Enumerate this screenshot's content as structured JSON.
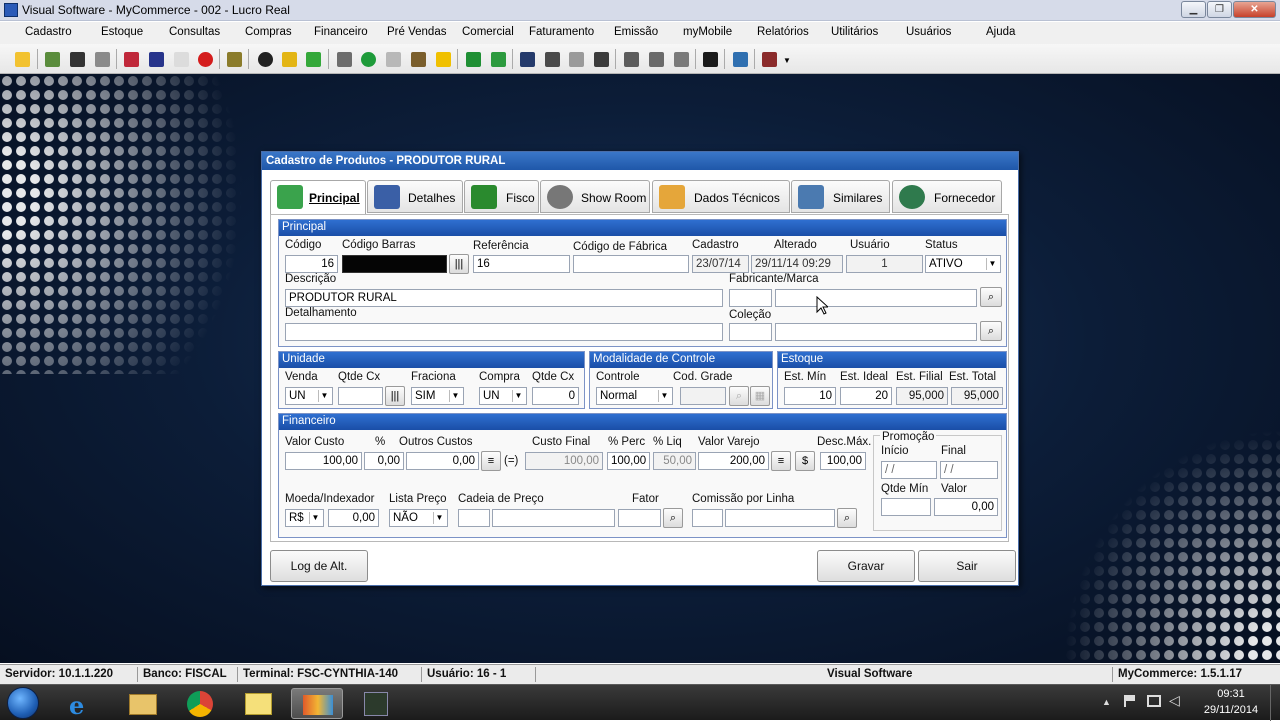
{
  "window": {
    "title": "Visual Software - MyCommerce - 002 - Lucro Real"
  },
  "menu": [
    "Cadastro",
    "Estoque",
    "Consultas",
    "Compras",
    "Financeiro",
    "Pré Vendas",
    "Comercial",
    "Faturamento",
    "Emissão",
    "myMobile",
    "Relatórios",
    "Utilitários",
    "Usuários",
    "Ajuda"
  ],
  "dialog": {
    "title": "Cadastro de Produtos - PRODUTOR RURAL",
    "tabs": [
      "Principal",
      "Detalhes",
      "Fisco",
      "Show Room",
      "Dados Técnicos",
      "Similares",
      "Fornecedor"
    ],
    "principal": {
      "header": "Principal",
      "codigo_label": "Código",
      "codigo": "16",
      "codigo_barras_label": "Código Barras",
      "referencia_label": "Referência",
      "referencia": "16",
      "codigo_fabrica_label": "Código de Fábrica",
      "cadastro_label": "Cadastro",
      "cadastro": "23/07/14",
      "alterado_label": "Alterado",
      "alterado": "29/11/14 09:29",
      "usuario_label": "Usuário",
      "usuario": "1",
      "status_label": "Status",
      "status": "ATIVO",
      "descricao_label": "Descrição",
      "descricao": "PRODUTOR RURAL",
      "fabricante_label": "Fabricante/Marca",
      "detalhamento_label": "Detalhamento",
      "colecao_label": "Coleção"
    },
    "unidade": {
      "header": "Unidade",
      "venda_label": "Venda",
      "venda": "UN",
      "qtde_cx_label": "Qtde Cx",
      "fraciona_label": "Fraciona",
      "fraciona": "SIM",
      "compra_label": "Compra",
      "compra": "UN",
      "qtde_cx2_label": "Qtde Cx",
      "qtde_cx2": "0"
    },
    "modalidade": {
      "header": "Modalidade de Controle",
      "controle_label": "Controle",
      "controle": "Normal",
      "cod_grade_label": "Cod. Grade"
    },
    "estoque": {
      "header": "Estoque",
      "est_min_label": "Est. Mín",
      "est_min": "10",
      "est_ideal_label": "Est. Ideal",
      "est_ideal": "20",
      "est_filial_label": "Est. Filial",
      "est_filial": "95,000",
      "est_total_label": "Est. Total",
      "est_total": "95,000"
    },
    "financeiro": {
      "header": "Financeiro",
      "valor_custo_label": "Valor Custo",
      "valor_custo": "100,00",
      "pct_label": "%",
      "pct": "0,00",
      "outros_custos_label": "Outros Custos",
      "outros_custos": "0,00",
      "equals": "(=)",
      "custo_final_label": "Custo Final",
      "custo_final": "100,00",
      "pct_perc_label": "% Perc",
      "pct_perc": "100,00",
      "pct_liq_label": "% Liq",
      "pct_liq": "50,00",
      "valor_varejo_label": "Valor Varejo",
      "valor_varejo": "200,00",
      "dollar": "$",
      "desc_max_label": "Desc.Máx.",
      "desc_max": "100,00",
      "moeda_label": "Moeda/Indexador",
      "moeda": "R$",
      "indexador": "0,00",
      "lista_preco_label": "Lista Preço",
      "lista_preco": "NÃO",
      "cadeia_preco_label": "Cadeia de Preço",
      "fator_label": "Fator",
      "comissao_label": "Comissão por Linha",
      "promocao": {
        "label": "Promoção",
        "inicio_label": "Início",
        "inicio": " /  /",
        "final_label": "Final",
        "final": " /  /",
        "qtde_min_label": "Qtde Mín",
        "valor_label": "Valor",
        "valor": "0,00"
      }
    },
    "buttons": {
      "log": "Log de Alt.",
      "gravar": "Gravar",
      "sair": "Sair"
    }
  },
  "status": {
    "servidor": "Servidor: 10.1.1.220",
    "banco": "Banco: FISCAL",
    "terminal": "Terminal: FSC-CYNTHIA-140",
    "usuario": "Usuário: 16 - 1",
    "empresa": "Visual Software",
    "versao": "MyCommerce: 1.5.1.17"
  },
  "clock": {
    "time": "09:31",
    "date": "29/11/2014"
  },
  "colors": {
    "accent": "#1f57a9",
    "section_header": "#2f6fd0",
    "desktop": "#0c1d38"
  }
}
